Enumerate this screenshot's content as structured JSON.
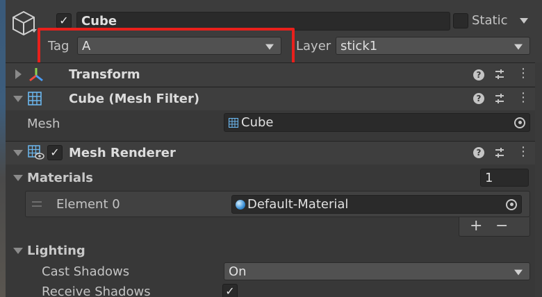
{
  "gameobject": {
    "name": "Cube",
    "active_checked": "✓",
    "static_label": "Static",
    "tag_label": "Tag",
    "tag_value": "A",
    "layer_label": "Layer",
    "layer_value": "stick1"
  },
  "components": {
    "transform": {
      "title": "Transform",
      "expanded": false
    },
    "mesh_filter": {
      "title": "Cube (Mesh Filter)",
      "mesh_label": "Mesh",
      "mesh_value": "Cube"
    },
    "mesh_renderer": {
      "title": "Mesh Renderer",
      "enabled_check": "✓",
      "materials_label": "Materials",
      "materials_count": "1",
      "element_label": "Element 0",
      "element_value": "Default-Material",
      "add_label": "+",
      "remove_label": "−",
      "lighting_label": "Lighting",
      "cast_shadows_label": "Cast Shadows",
      "cast_shadows_value": "On",
      "receive_shadows_label": "Receive Shadows",
      "receive_shadows_check": "✓"
    }
  },
  "icons": {
    "help": "?",
    "kebab": "⋮"
  },
  "colors": {
    "highlight_box": "#e8201c",
    "panel_bg": "#383838",
    "field_bg": "#2a2a2a"
  }
}
